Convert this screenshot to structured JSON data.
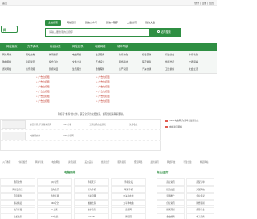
{
  "topbar": {
    "home": "首页",
    "right": "登录 | 注册 | 会员"
  },
  "logo": {
    "text": "网"
  },
  "search_tabs": [
    "全站搜索",
    "网站目录",
    "微信公众号",
    "微信小程序",
    "文章资讯",
    "微信文章"
  ],
  "search": {
    "placeholder": "请输入要搜索的关键字",
    "button": "站内搜索"
  },
  "nav": [
    "网站首页",
    "文章资讯",
    "行业分类",
    "网站目录",
    "电脑网络",
    "城市导航"
  ],
  "subnav_rows": [
    [
      "网址导航",
      "网站分类",
      "休闲娱乐",
      "电脑网络",
      "生活服务",
      "教育文化",
      "综合其他",
      "行业企业",
      "体育健身"
    ],
    [
      "购物网站",
      "新闻资讯",
      "综合门户",
      "文学小说",
      "艺术设计",
      "网络科技",
      "医疗健康",
      "旅游出行",
      "交通运输"
    ],
    [
      "游戏网站",
      "音乐视频",
      "影视动漫",
      "生活服务",
      "金融理财",
      "房产家居",
      "汽车交通",
      "卫生健康",
      "社会生活"
    ]
  ],
  "ads_left": [
    "广告位招租",
    "广告位招租",
    "广告位招租",
    "广告位招租",
    "广告位招租",
    "广告位招租"
  ],
  "ads_right": [
    "广告位招租",
    "广告位招租",
    "广告位招租",
    "广告位招租",
    "广告位招租",
    "广告位招租"
  ],
  "notice": "除标有\"推荐\"的以外，其它全部为免费收录，如有侵权请联系删除。",
  "listing": [
    {
      "a": "魔兽世界_手游版本官网",
      "b": "365小说",
      "c": "王牌战机在线游戏",
      "d": "免费收录"
    },
    {
      "a": "电脑网文章",
      "b": "365小说网",
      "c": "",
      "d": ""
    }
  ],
  "side_news": [
    "5201电脑网_为您奉上最新信息",
    "电脑资讯网站"
  ],
  "tags": [
    "入门教程",
    "休闲娱乐",
    "网址导航",
    "电脑网络",
    "资讯频道",
    "美食美客",
    "旅游出行",
    "服务频道",
    "聚焦网络",
    "最新资讯",
    "网络科技",
    "行业企业",
    "精选网站"
  ],
  "sections": {
    "left": "电脑网络",
    "right": "商业经济"
  },
  "grid_left": [
    [
      "腾讯软件",
      "QQ音乐",
      "手机天下",
      "手机论坛"
    ],
    [
      "网易云音乐",
      "酷狗音乐",
      "华为手机",
      "苹果手机"
    ],
    [
      "百度网盘",
      "迅雷下载",
      "小米官网",
      "中关村在线"
    ],
    [
      "驱动精灵",
      "360安全",
      "电脑之家",
      "太平洋电脑"
    ],
    [
      "软件下载",
      "IT之家",
      "电子商务",
      "雷锋网"
    ],
    [
      "站长之家",
      "A5站长",
      "CSDN",
      "博客园"
    ]
  ],
  "grid_right": [
    [
      "商业资讯",
      "商贸订单"
    ],
    [
      "招商加盟",
      "外贸网站"
    ],
    [
      "营销推广",
      "企业名录"
    ],
    [
      "创业资讯",
      "财经新闻"
    ],
    [
      "投资理财",
      "保险行业"
    ],
    [
      "金融经济",
      "电子商务"
    ]
  ]
}
